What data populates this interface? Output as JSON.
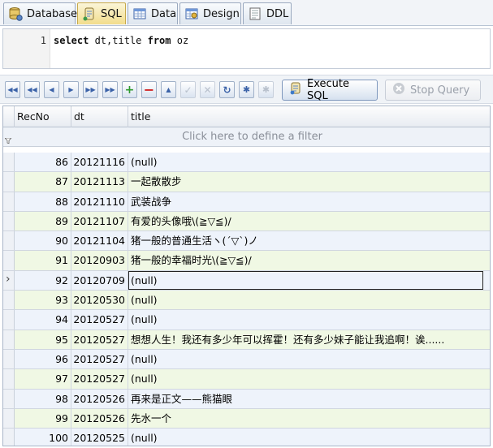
{
  "tabs": [
    {
      "label": "Database",
      "icon": "database-icon",
      "active": false
    },
    {
      "label": "SQL",
      "icon": "sql-scroll-icon",
      "active": true
    },
    {
      "label": "Data",
      "icon": "data-grid-icon",
      "active": false
    },
    {
      "label": "Design",
      "icon": "design-table-icon",
      "active": false
    },
    {
      "label": "DDL",
      "icon": "ddl-document-icon",
      "active": false
    }
  ],
  "editor": {
    "line_number": "1",
    "kw_select": "select",
    "cols": " dt,title ",
    "kw_from": "from",
    "table": " oz"
  },
  "toolbar": {
    "execute_label": "Execute SQL",
    "stop_label": "Stop Query"
  },
  "grid": {
    "columns": [
      "RecNo",
      "dt",
      "title"
    ],
    "filter_hint": "Click here to define a filter",
    "rows": [
      {
        "recno": "86",
        "dt": "20121116",
        "title": "(null)"
      },
      {
        "recno": "87",
        "dt": "20121113",
        "title": "一起散散步"
      },
      {
        "recno": "88",
        "dt": "20121110",
        "title": "武装战争"
      },
      {
        "recno": "89",
        "dt": "20121107",
        "title": "有爱的头像哦\\(≧▽≦)/"
      },
      {
        "recno": "90",
        "dt": "20121104",
        "title": "猪一般的普通生活ヽ(´▽`)ノ"
      },
      {
        "recno": "91",
        "dt": "20120903",
        "title": "猪一般的幸福时光\\(≧▽≦)/"
      },
      {
        "recno": "92",
        "dt": "20120709",
        "title": "(null)"
      },
      {
        "recno": "93",
        "dt": "20120530",
        "title": "(null)"
      },
      {
        "recno": "94",
        "dt": "20120527",
        "title": "(null)"
      },
      {
        "recno": "95",
        "dt": "20120527",
        "title": "想想人生！我还有多少年可以挥霍！还有多少妹子能让我追啊！诶......"
      },
      {
        "recno": "96",
        "dt": "20120527",
        "title": "(null)"
      },
      {
        "recno": "97",
        "dt": "20120527",
        "title": "(null)"
      },
      {
        "recno": "98",
        "dt": "20120526",
        "title": "再来是正文——熊猫眼"
      },
      {
        "recno": "99",
        "dt": "20120526",
        "title": "先水一个"
      },
      {
        "recno": "100",
        "dt": "20120525",
        "title": "(null)"
      }
    ]
  },
  "colors": {
    "row_green": "#f0f8e4",
    "row_blue": "#eef3fb",
    "active_tab": "#f2dd8c"
  }
}
